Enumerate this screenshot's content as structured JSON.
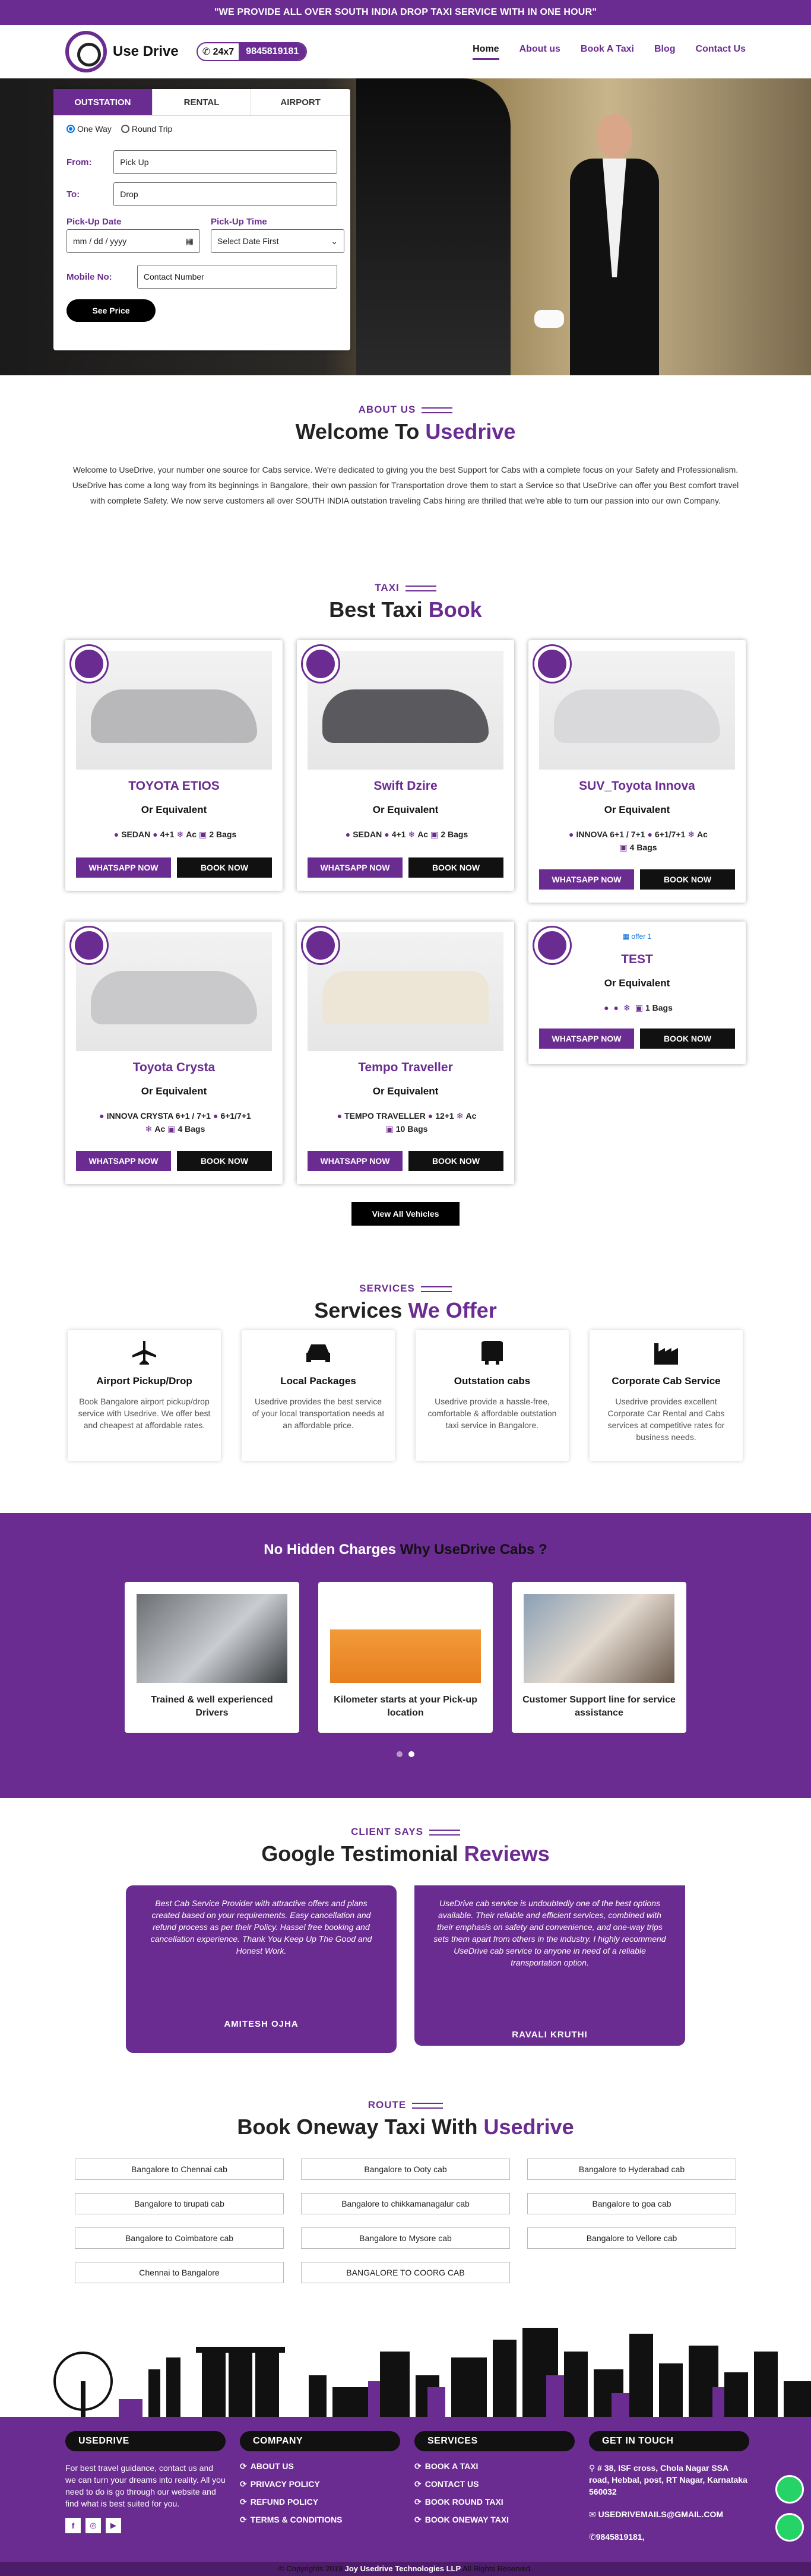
{
  "topbar": {
    "text": "\"WE PROVIDE ALL OVER SOUTH INDIA DROP TAXI SERVICE WITH IN ONE HOUR\""
  },
  "header": {
    "logo_text": "Use Drive",
    "phone_prefix": "24x7",
    "phone": "9845819181",
    "nav": [
      "Home",
      "About us",
      "Book A Taxi",
      "Blog",
      "Contact Us"
    ]
  },
  "booking": {
    "tabs": [
      "OUTSTATION",
      "RENTAL",
      "AIRPORT"
    ],
    "trip_types": [
      "One Way",
      "Round Trip"
    ],
    "from_label": "From:",
    "from_placeholder": "Pick Up",
    "to_label": "To:",
    "to_placeholder": "Drop",
    "date_label": "Pick-Up Date",
    "date_placeholder": "mm / dd / yyyy",
    "time_label": "Pick-Up Time",
    "time_value": "Select Date First",
    "mobile_label": "Mobile No:",
    "mobile_placeholder": "Contact Number",
    "submit": "See Price"
  },
  "about": {
    "label": "ABOUT US",
    "title_a": "Welcome To",
    "title_b": "Usedrive",
    "text": "Welcome to UseDrive, your number one source for Cabs service. We're dedicated to giving you the best Support for Cabs  with a complete focus on your Safety and Professionalism. UseDrive has come a long way from its beginnings in Bangalore, their own passion for Transportation drove them to start a Service so that UseDrive can offer you Best comfort travel with complete Safety. We now serve customers all over SOUTH INDIA  outstation traveling Cabs  hiring are thrilled that we're able to turn our passion into our own Company."
  },
  "taxi": {
    "label": "TAXI",
    "title_a": "Best Taxi",
    "title_b": "Book",
    "or_equivalent": "Or Equivalent",
    "whatsapp": "WHATSAPP NOW",
    "book": "BOOK NOW",
    "view_all": "View All Vehicles",
    "cars": [
      {
        "name": "TOYOTA ETIOS",
        "type": "SEDAN",
        "seats": "4+1",
        "ac": "Ac",
        "bags": "2 Bags",
        "color": "#b8b8bb"
      },
      {
        "name": "Swift Dzire",
        "type": "SEDAN",
        "seats": "4+1",
        "ac": "Ac",
        "bags": "2 Bags",
        "color": "#5a5a5e"
      },
      {
        "name": "SUV_Toyota Innova",
        "type": "INNOVA 6+1 / 7+1",
        "seats": "6+1/7+1",
        "ac": "Ac",
        "bags": "4 Bags",
        "color": "#d9d9dc"
      },
      {
        "name": "Toyota Crysta",
        "type": "INNOVA CRYSTA 6+1 / 7+1",
        "seats": "6+1/7+1",
        "ac": "Ac",
        "bags": "4 Bags",
        "color": "#c9c9cc"
      },
      {
        "name": "Tempo Traveller",
        "type": "TEMPO TRAVELLER",
        "seats": "12+1",
        "ac": "Ac",
        "bags": "10 Bags",
        "color": "#ede6d6"
      },
      {
        "name": "TEST",
        "type": "",
        "seats": "",
        "ac": "",
        "bags": "1 Bags",
        "alt": "offer 1",
        "color": ""
      }
    ]
  },
  "services": {
    "label": "SERVICES",
    "title_a": "Services",
    "title_b": "We Offer",
    "items": [
      {
        "title": "Airport Pickup/Drop",
        "text": "Book Bangalore airport pickup/drop service with Usedrive. We offer best and cheapest at affordable rates.",
        "icon": "airplane-icon"
      },
      {
        "title": "Local Packages",
        "text": "Usedrive provides the best service of your local transportation needs at an affordable price.",
        "icon": "car-icon"
      },
      {
        "title": "Outstation cabs",
        "text": "Usedrive provide a hassle-free, comfortable & affordable outstation taxi service in Bangalore.",
        "icon": "bus-icon"
      },
      {
        "title": "Corporate Cab Service",
        "text": "Usedrive provides excellent Corporate Car Rental and Cabs services at competitive rates for business needs.",
        "icon": "factory-icon"
      }
    ]
  },
  "why": {
    "title_a": "No Hidden Charges",
    "title_b": "Why UseDrive Cabs ?",
    "cards": [
      "Trained & well experienced Drivers",
      "Kilometer starts at your Pick-up location",
      "Customer Support line for service assistance"
    ]
  },
  "testimonials": {
    "label": "CLIENT SAYS",
    "title_a": "Google Testimonial",
    "title_b": "Reviews",
    "items": [
      {
        "text": "Best Cab Service Provider with attractive offers and plans created based on your requirements. Easy cancellation and refund process as per their Policy. Hassel free booking and cancellation experience. Thank You Keep Up The Good and Honest Work.",
        "name": "AMITESH OJHA"
      },
      {
        "text": "UseDrive cab service is undoubtedly one of the best options available. Their reliable and efficient services, combined with their emphasis on safety and convenience, and one-way trips sets them apart from others in the industry. I highly recommend UseDrive cab service to anyone in need of a reliable transportation option.",
        "name": "RAVALI KRUTHI"
      }
    ]
  },
  "route": {
    "label": "ROUTE",
    "title_a": "Book Oneway Taxi With",
    "title_b": "Usedrive",
    "items": [
      "Bangalore to Chennai cab",
      "Bangalore to Ooty cab",
      "Bangalore to Hyderabad cab",
      "Bangalore to tirupati cab",
      "Bangalore to chikkamanagalur cab",
      "Bangalore to goa cab",
      "Bangalore to Coimbatore cab",
      "Bangalore to Mysore cab",
      "Bangalore to Vellore cab",
      "Chennai to Bangalore",
      "BANGALORE TO COORG CAB"
    ]
  },
  "footer": {
    "col1_title": "USEDRIVE",
    "col1_text": "For best travel guidance, contact us and we can turn your dreams into reality. All you need to do is go through our website and find what is best suited for you.",
    "social": [
      "f",
      "◎",
      "▶"
    ],
    "col2_title": "COMPANY",
    "col2_links": [
      "ABOUT US",
      "PRIVACY POLICY",
      "REFUND POLICY",
      "TERMS & CONDITIONS"
    ],
    "col3_title": "SERVICES",
    "col3_links": [
      "BOOK A TAXI",
      "CONTACT US",
      "BOOK ROUND TAXI",
      "BOOK ONEWAY TAXI"
    ],
    "col4_title": "GET IN TOUCH",
    "address": "# 38, ISF cross, Chola Nagar SSA road, Hebbal, post, RT Nagar, Karnataka 560032",
    "email": "USEDRIVEMAILS@GMAIL.COM",
    "phone": "9845819181,",
    "copyright_a": "© Copyrights 2019",
    "copyright_b": "Joy Usedrive Technologies LLP",
    "copyright_c": "All Rights Reserved."
  }
}
